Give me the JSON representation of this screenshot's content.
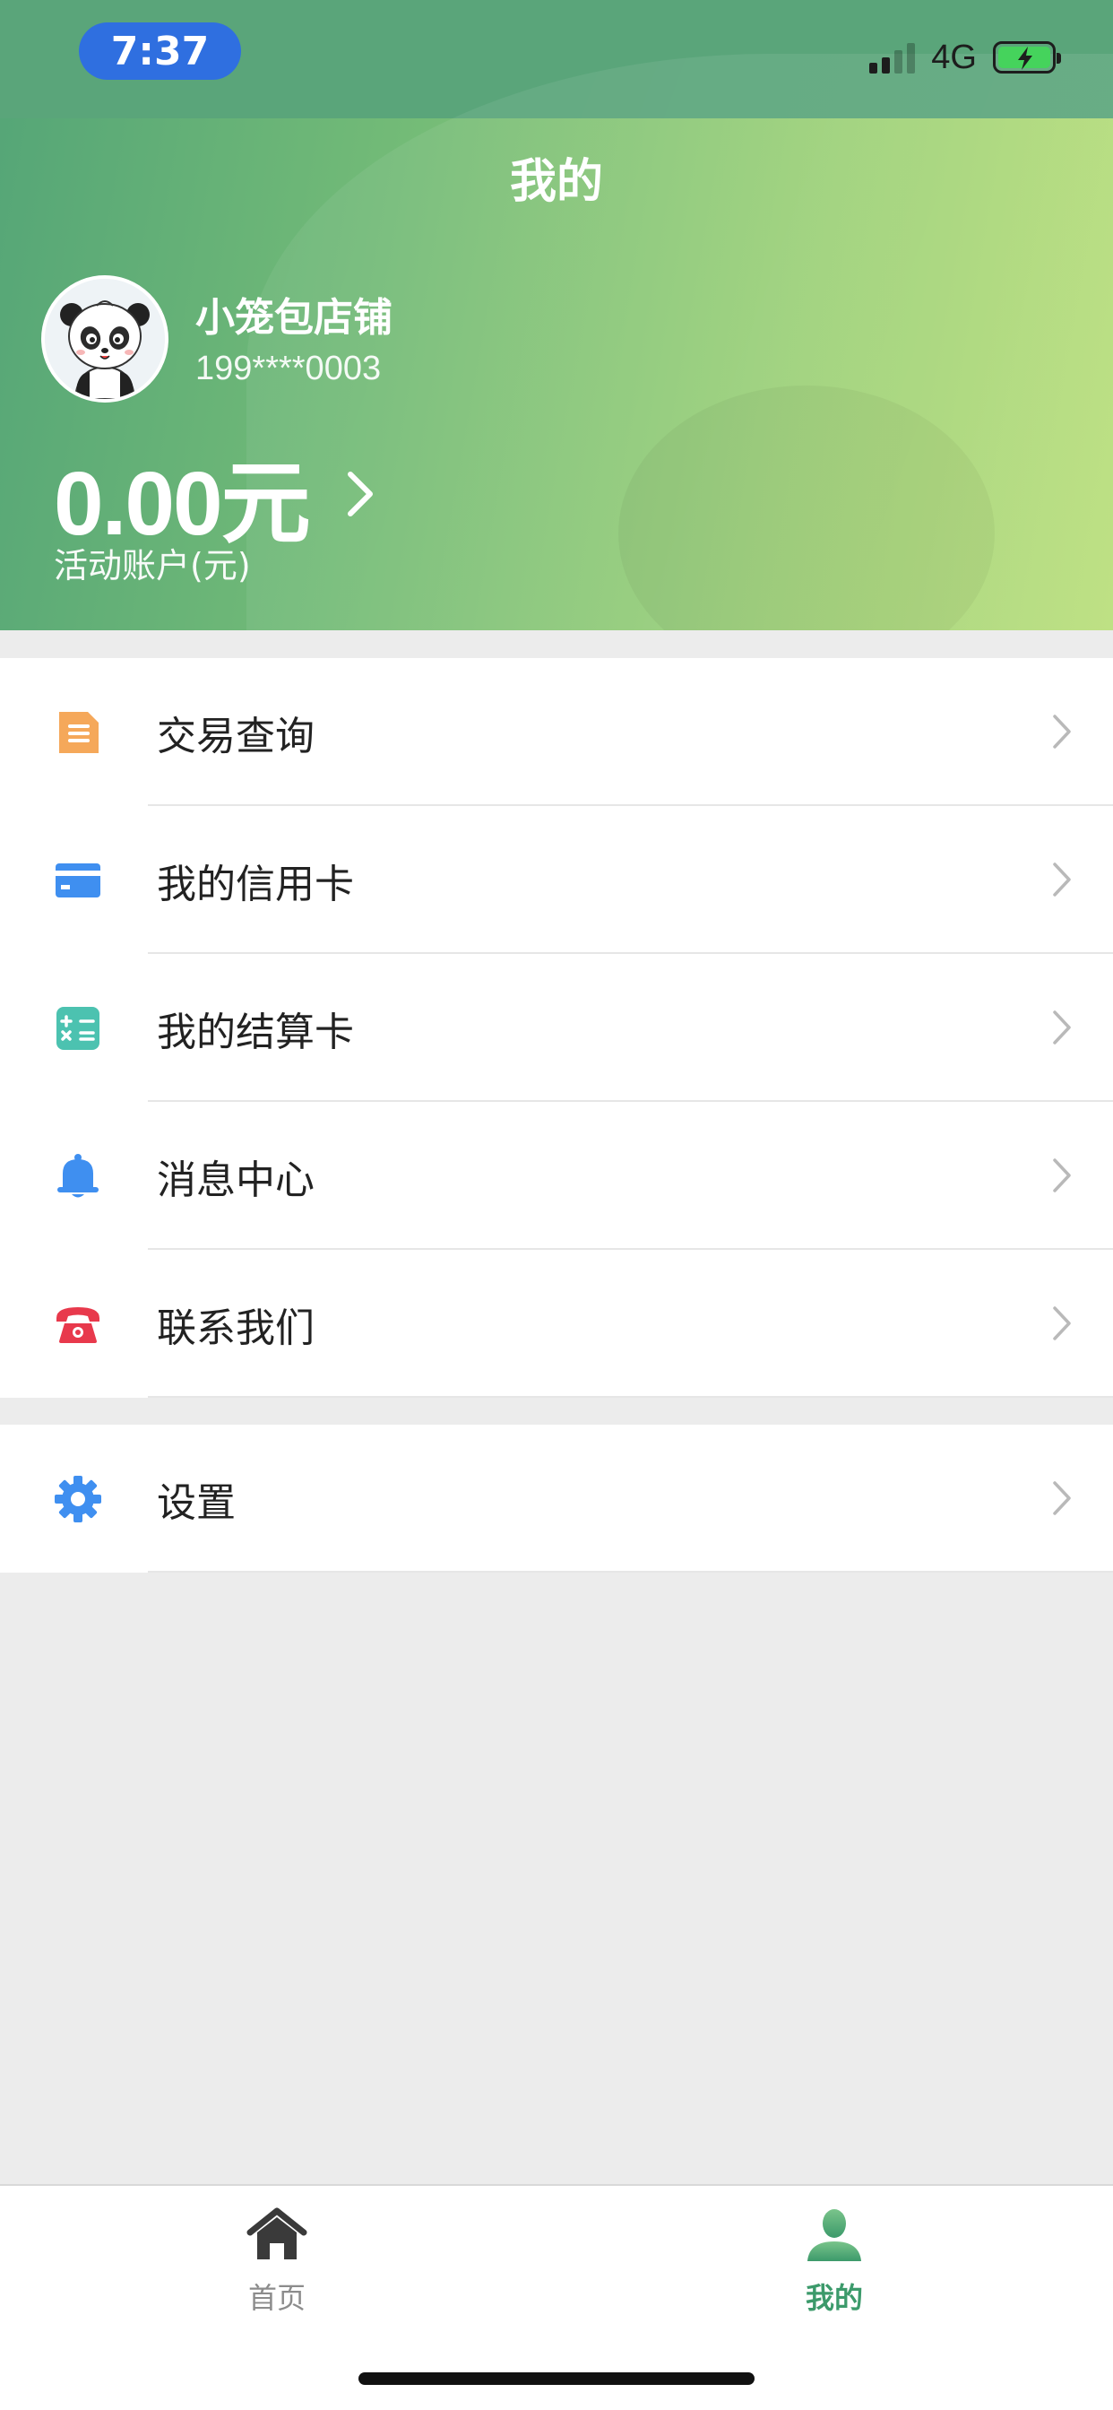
{
  "status_bar": {
    "time": "7:37",
    "network": "4G"
  },
  "header": {
    "title": "我的",
    "shop_name": "小笼包店铺",
    "phone": "199****0003",
    "balance": "0.00元",
    "balance_label": "活动账户(元)"
  },
  "menu": {
    "group1": [
      {
        "label": "交易查询",
        "icon": "document-icon",
        "color": "#f5a85a"
      },
      {
        "label": "我的信用卡",
        "icon": "credit-card-icon",
        "color": "#3f8ff0"
      },
      {
        "label": "我的结算卡",
        "icon": "calculator-icon",
        "color": "#4cc2b0"
      },
      {
        "label": "消息中心",
        "icon": "bell-icon",
        "color": "#3f8ff0"
      },
      {
        "label": "联系我们",
        "icon": "telephone-icon",
        "color": "#e8394c"
      }
    ],
    "group2": [
      {
        "label": "设置",
        "icon": "gear-icon",
        "color": "#3f8ff0"
      }
    ]
  },
  "tabbar": {
    "home_label": "首页",
    "mine_label": "我的",
    "active_color": "#3c9a6b"
  }
}
